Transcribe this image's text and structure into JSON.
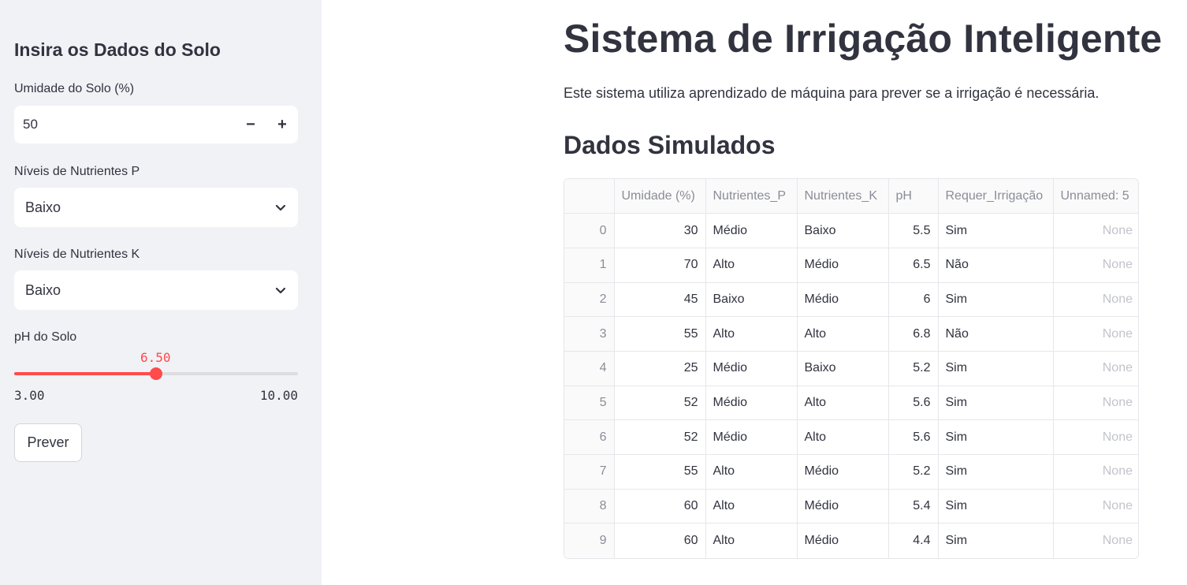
{
  "sidebar": {
    "heading": "Insira os Dados do Solo",
    "moisture": {
      "label": "Umidade do Solo (%)",
      "value": "50",
      "decrement_label": "−",
      "increment_label": "+"
    },
    "nutrient_p": {
      "label": "Níveis de Nutrientes P",
      "selected": "Baixo"
    },
    "nutrient_k": {
      "label": "Níveis de Nutrientes K",
      "selected": "Baixo"
    },
    "ph": {
      "label": "pH do Solo",
      "value_label": "6.50",
      "value": 6.5,
      "min_label": "3.00",
      "max_label": "10.00",
      "min": 3.0,
      "max": 10.0
    },
    "predict_button": "Prever"
  },
  "main": {
    "title": "Sistema de Irrigação Inteligente",
    "description": "Este sistema utiliza aprendizado de máquina para prever se a irrigação é necessária.",
    "section_title": "Dados Simulados",
    "table": {
      "columns": [
        "",
        "Umidade (%)",
        "Nutrientes_P",
        "Nutrientes_K",
        "pH",
        "Requer_Irrigação",
        "Unnamed: 5"
      ],
      "rows": [
        [
          "0",
          "30",
          "Médio",
          "Baixo",
          "5.5",
          "Sim",
          "None"
        ],
        [
          "1",
          "70",
          "Alto",
          "Médio",
          "6.5",
          "Não",
          "None"
        ],
        [
          "2",
          "45",
          "Baixo",
          "Médio",
          "6",
          "Sim",
          "None"
        ],
        [
          "3",
          "55",
          "Alto",
          "Alto",
          "6.8",
          "Não",
          "None"
        ],
        [
          "4",
          "25",
          "Médio",
          "Baixo",
          "5.2",
          "Sim",
          "None"
        ],
        [
          "5",
          "52",
          "Médio",
          "Alto",
          "5.6",
          "Sim",
          "None"
        ],
        [
          "6",
          "52",
          "Médio",
          "Alto",
          "5.6",
          "Sim",
          "None"
        ],
        [
          "7",
          "55",
          "Alto",
          "Médio",
          "5.2",
          "Sim",
          "None"
        ],
        [
          "8",
          "60",
          "Alto",
          "Médio",
          "5.4",
          "Sim",
          "None"
        ],
        [
          "9",
          "60",
          "Alto",
          "Médio",
          "4.4",
          "Sim",
          "None"
        ]
      ]
    }
  },
  "colors": {
    "accent": "#ff4b4b",
    "sidebar_bg": "#f0f2f6",
    "text": "#31333f"
  }
}
